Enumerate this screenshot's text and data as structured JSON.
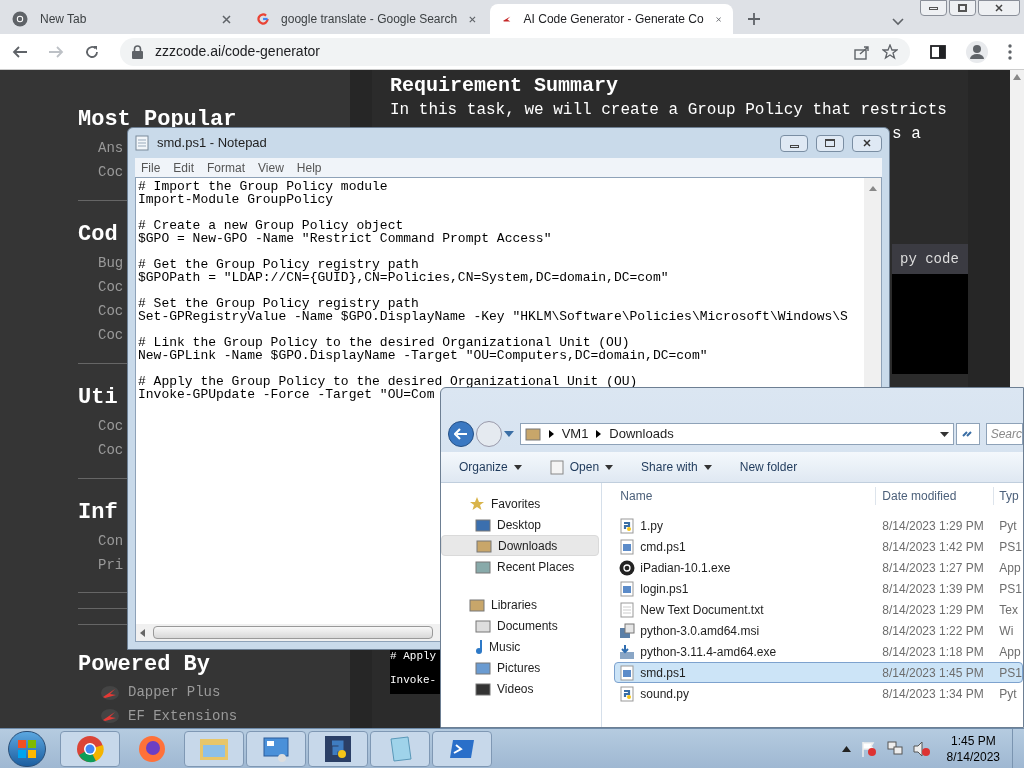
{
  "browser": {
    "tabs": [
      {
        "title": "New Tab",
        "kind": "chrome",
        "selected": false
      },
      {
        "title": "google translate - Google Search",
        "kind": "google",
        "selected": false
      },
      {
        "title": "AI Code Generator - Generate Co",
        "kind": "zzz",
        "selected": true
      }
    ],
    "url": "zzzcode.ai/code-generator"
  },
  "website": {
    "sidebar": [
      {
        "heading": "Most Popular",
        "links": [
          "Ans",
          "Coc"
        ]
      },
      {
        "heading": "Cod",
        "links": [
          "Bug",
          "Coc",
          "Coc",
          "Coc"
        ]
      },
      {
        "heading": "Uti",
        "links": [
          "Coc",
          "Coc"
        ]
      },
      {
        "heading": "Inf",
        "links": [
          "Con",
          "Pri"
        ]
      }
    ],
    "powered_by": {
      "heading": "Powered By",
      "links": [
        "Dapper Plus",
        "EF Extensions"
      ]
    },
    "main": {
      "heading": "Requirement Summary",
      "paragraph": "In this task, we will create a Group Policy that restricts",
      "paragraph_tail": "s a",
      "copy_label": "py code",
      "code_lines": [
        "# Apply",
        "Invoke-"
      ]
    }
  },
  "notepad": {
    "title": "smd.ps1 - Notepad",
    "menu": [
      "File",
      "Edit",
      "Format",
      "View",
      "Help"
    ],
    "blocks": [
      [
        "# Import the Group Policy module",
        "Import-Module GroupPolicy"
      ],
      [
        "# Create a new Group Policy object",
        "$GPO = New-GPO -Name \"Restrict Command Prompt Access\""
      ],
      [
        "# Get the Group Policy registry path",
        "$GPOPath = \"LDAP://CN={GUID},CN=Policies,CN=System,DC=domain,DC=com\""
      ],
      [
        "# Set the Group Policy registry path",
        "Set-GPRegistryValue -Name $GPO.DisplayName -Key \"HKLM\\Software\\Policies\\Microsoft\\Windows\\S"
      ],
      [
        "# Link the Group Policy to the desired Organizational Unit (OU)",
        "New-GPLink -Name $GPO.DisplayName -Target \"OU=Computers,DC=domain,DC=com\""
      ],
      [
        "# Apply the Group Policy to the desired Organizational Unit (OU)",
        "Invoke-GPUpdate -Force -Target \"OU=Com"
      ]
    ]
  },
  "explorer": {
    "breadcrumb": [
      "VM1",
      "Downloads"
    ],
    "search_placeholder": "Searc",
    "toolbar": [
      {
        "label": "Organize",
        "kind": "menu"
      },
      {
        "label": "Open",
        "kind": "open"
      },
      {
        "label": "Share with",
        "kind": "menu"
      },
      {
        "label": "New folder",
        "kind": "plain"
      }
    ],
    "nav": [
      {
        "label": "Favorites",
        "kind": "star",
        "selected": false,
        "children": [
          {
            "label": "Desktop",
            "kind": "desktop",
            "selected": false
          },
          {
            "label": "Downloads",
            "kind": "downloads",
            "selected": true
          },
          {
            "label": "Recent Places",
            "kind": "recent",
            "selected": false
          }
        ]
      },
      {
        "label": "Libraries",
        "kind": "libraries",
        "selected": false,
        "children": [
          {
            "label": "Documents",
            "kind": "documents",
            "selected": false
          },
          {
            "label": "Music",
            "kind": "music",
            "selected": false
          },
          {
            "label": "Pictures",
            "kind": "pictures",
            "selected": false
          },
          {
            "label": "Videos",
            "kind": "videos",
            "selected": false
          }
        ]
      }
    ],
    "columns": [
      "Name",
      "Date modified",
      "Typ"
    ],
    "files": [
      {
        "name": "1.py",
        "date": "8/14/2023 1:29 PM",
        "type": "Pyt",
        "kind": "py",
        "selected": false
      },
      {
        "name": "cmd.ps1",
        "date": "8/14/2023 1:42 PM",
        "type": "PS1",
        "kind": "ps1",
        "selected": false
      },
      {
        "name": "iPadian-10.1.exe",
        "date": "8/14/2023 1:27 PM",
        "type": "App",
        "kind": "ios",
        "selected": false
      },
      {
        "name": "login.ps1",
        "date": "8/14/2023 1:39 PM",
        "type": "PS1",
        "kind": "ps1",
        "selected": false
      },
      {
        "name": "New Text Document.txt",
        "date": "8/14/2023 1:29 PM",
        "type": "Tex",
        "kind": "txt",
        "selected": false
      },
      {
        "name": "python-3.0.amd64.msi",
        "date": "8/14/2023 1:22 PM",
        "type": "Wi",
        "kind": "msi",
        "selected": false
      },
      {
        "name": "python-3.11.4-amd64.exe",
        "date": "8/14/2023 1:18 PM",
        "type": "App",
        "kind": "exe",
        "selected": false
      },
      {
        "name": "smd.ps1",
        "date": "8/14/2023 1:45 PM",
        "type": "PS1",
        "kind": "ps1",
        "selected": true
      },
      {
        "name": "sound.py",
        "date": "8/14/2023 1:34 PM",
        "type": "Pyt",
        "kind": "py",
        "selected": false
      }
    ]
  },
  "taskbar": {
    "apps": [
      {
        "kind": "chrome",
        "running": true
      },
      {
        "kind": "firefox",
        "running": false
      },
      {
        "kind": "explorer",
        "running": true
      },
      {
        "kind": "control",
        "running": true
      },
      {
        "kind": "python",
        "running": true
      },
      {
        "kind": "notepad",
        "running": true
      },
      {
        "kind": "powershell",
        "running": true
      }
    ],
    "time": "1:45 PM",
    "date": "8/14/2023"
  }
}
